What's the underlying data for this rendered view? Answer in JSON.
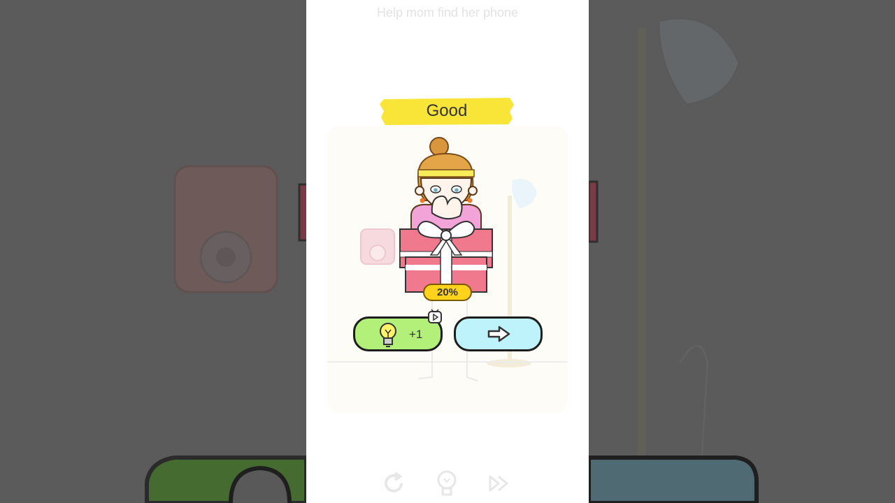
{
  "level": {
    "subtitle": "Help mom find her phone"
  },
  "result": {
    "rating": "Good",
    "progress_text": "20%",
    "progress_value": 0.2
  },
  "buttons": {
    "hint_count_label": "+1"
  },
  "icons": {
    "hint": "lightbulb-icon",
    "video": "video-ad-icon",
    "next": "arrow-right-icon",
    "restart": "restart-icon",
    "bottom_hint": "lightbulb-icon",
    "skip": "skip-icon"
  },
  "colors": {
    "banner": "#f9e537",
    "progress_badge": "#ffd21c",
    "hint_button": "#b2f07a",
    "next_button": "#bff3fb",
    "gift_box": "#f0798e",
    "background_dim": "#5b5b5b"
  }
}
